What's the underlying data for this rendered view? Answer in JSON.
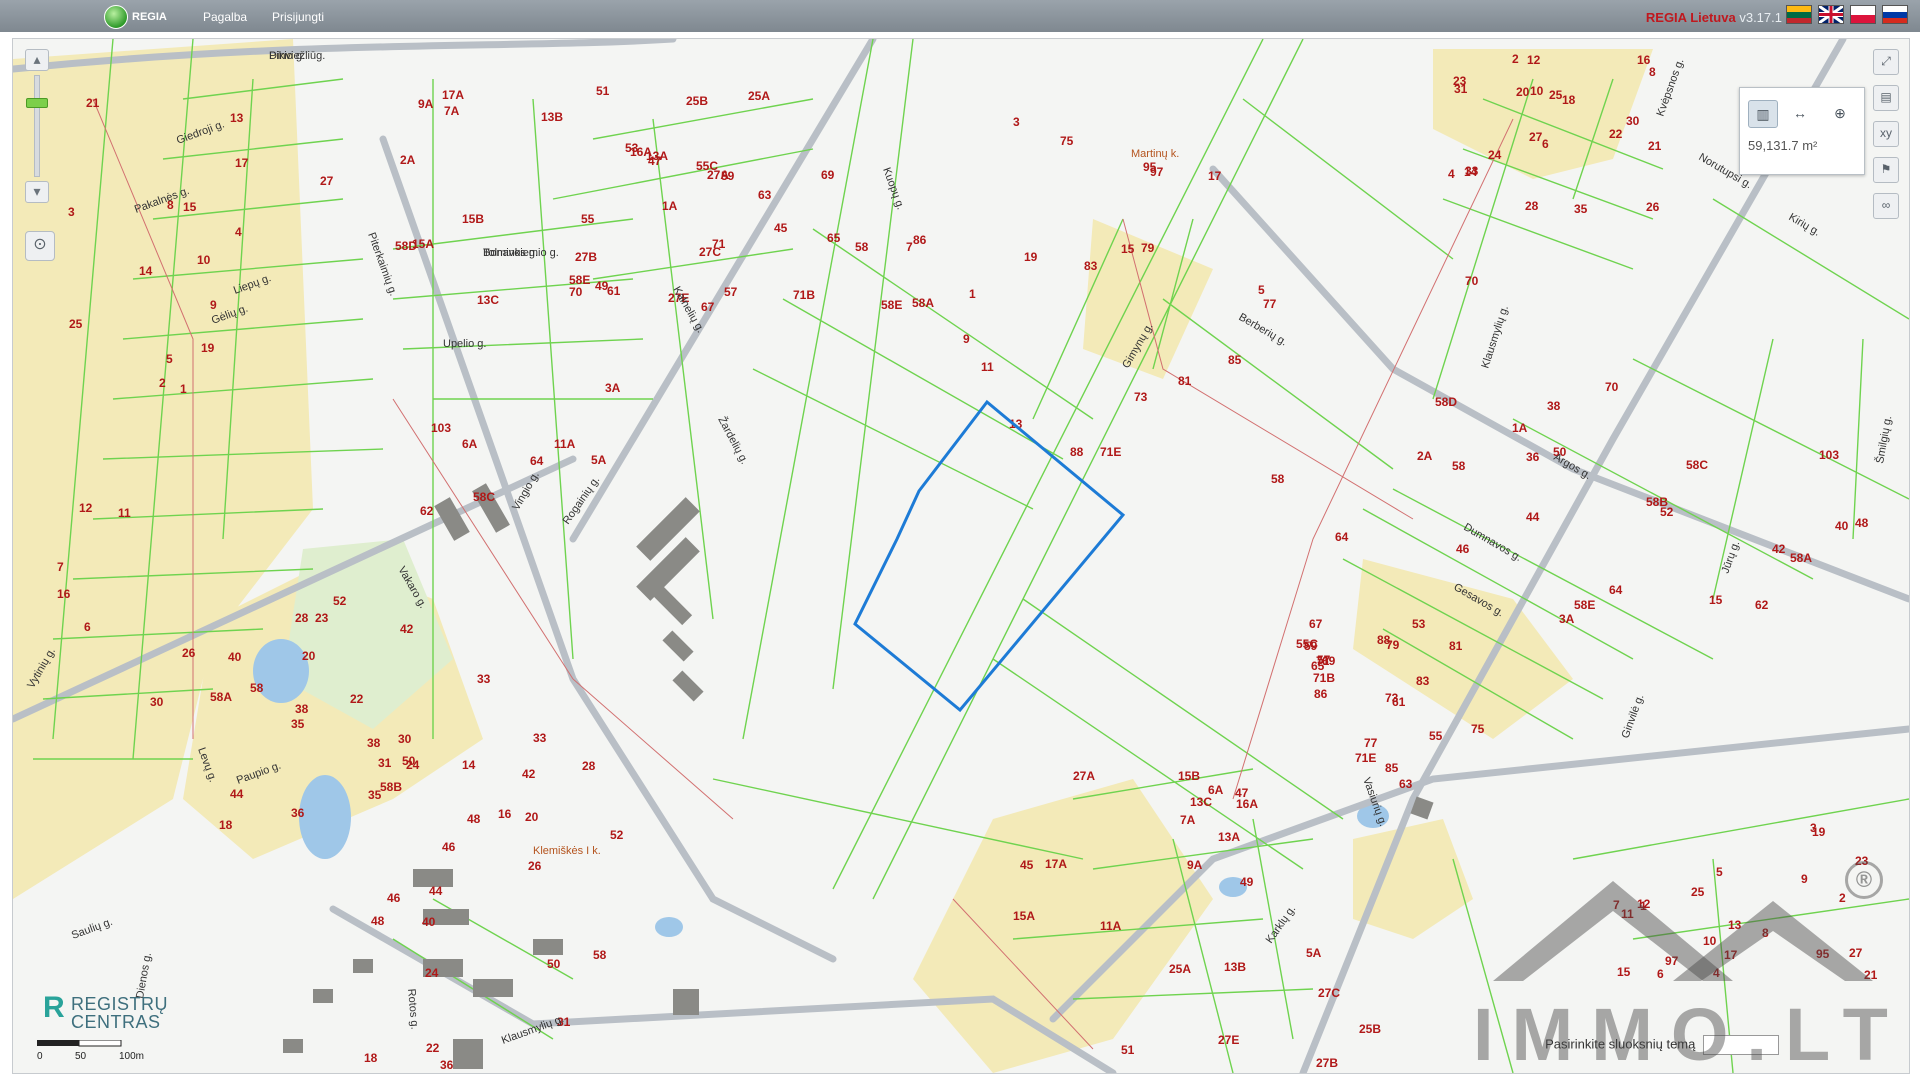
{
  "header": {
    "logo_text": "REGIA",
    "nav_help": "Pagalba",
    "nav_login": "Prisijungti",
    "app_name": "REGIA Lietuva",
    "version": "v3.17.1",
    "languages": [
      "lt",
      "en",
      "pl",
      "ru"
    ]
  },
  "map": {
    "controls": {
      "zoom_in_icon": "chevron-up-icon",
      "zoom_out_icon": "chevron-down-icon",
      "locate_icon": "locate-icon",
      "right_tools": [
        "fullscreen-icon",
        "measure-icon",
        "xy-icon",
        "flag-icon",
        "link-icon"
      ]
    },
    "measure_panel": {
      "tools": [
        "area-icon",
        "distance-icon",
        "point-icon"
      ],
      "area_value": "59,131.7 m²"
    },
    "streets": [
      "Pikio g.",
      "Bonavos g.",
      "Upelio g.",
      "Rogainių g.",
      "Vingio g.",
      "Žardelių g.",
      "Kuopų g.",
      "Kalnelių g.",
      "Berberių g.",
      "Klausmylių g.",
      "Argos g.",
      "Dumnavos g.",
      "Gesavos g.",
      "Klausmylių g.",
      "Rotos g.",
      "Paupio g.",
      "Levų g.",
      "Liepų g.",
      "Gėlių g.",
      "Giedroji g.",
      "Pakalnės g.",
      "Vytinių g.",
      "Saulių g.",
      "Dienos g.",
      "Vakaro g.",
      "Karklų g.",
      "Šmilgių g.",
      "Kvėpsnos g.",
      "Jūrų g.",
      "Ginvilė g.",
      "Norutupsi g.",
      "Kirių g.",
      "Piterkaimių g.",
      "Gimynų g.",
      "Vasiurių g.",
      "Dinviežliūg.",
      "Tolminkiemio g."
    ],
    "places": [
      "Martinų k.",
      "Klemiškės I k."
    ],
    "parcel_numbers": [
      "1",
      "3",
      "5",
      "7",
      "9",
      "11",
      "13",
      "15",
      "17",
      "19",
      "21",
      "23",
      "25",
      "27",
      "2",
      "4",
      "6",
      "8",
      "10",
      "12",
      "14",
      "16",
      "18",
      "20",
      "22",
      "24",
      "26",
      "28",
      "30",
      "31",
      "33",
      "35",
      "36",
      "38",
      "40",
      "42",
      "44",
      "46",
      "48",
      "50",
      "52",
      "58",
      "58A",
      "58B",
      "58C",
      "58D",
      "58E",
      "62",
      "64",
      "70",
      "103",
      "1A",
      "2A",
      "3A",
      "5A",
      "6A",
      "7A",
      "9A",
      "11A",
      "13A",
      "13B",
      "13C",
      "15A",
      "15B",
      "16A",
      "17A",
      "25A",
      "25B",
      "27A",
      "27B",
      "27C",
      "27E",
      "45",
      "47",
      "49",
      "51",
      "53",
      "55",
      "55C",
      "57",
      "59",
      "61",
      "63",
      "65",
      "67",
      "69",
      "71",
      "71B",
      "71E",
      "73",
      "75",
      "77",
      "79",
      "81",
      "83",
      "85",
      "86",
      "88",
      "95",
      "97"
    ],
    "scale": {
      "labels": [
        "0",
        "50",
        "100m"
      ]
    },
    "layer_selector": {
      "label": "Pasirinkite sluoksnių temą",
      "value": ""
    }
  },
  "branding": {
    "registry_logo_line1": "REGISTRŲ",
    "registry_logo_line2": "CENTRAS",
    "watermark": "IMMO.LT",
    "watermark_mark": "®"
  },
  "colors": {
    "parcel_line": "#6fd34f",
    "road_line": "#b9bfc6",
    "selected_parcel": "#1d7bd6",
    "label_red": "#b01818",
    "residential_fill": "#f3eab8",
    "building_fill": "#8a8a86",
    "water_fill": "#9fc7e8",
    "park_fill": "#dfeecf"
  }
}
